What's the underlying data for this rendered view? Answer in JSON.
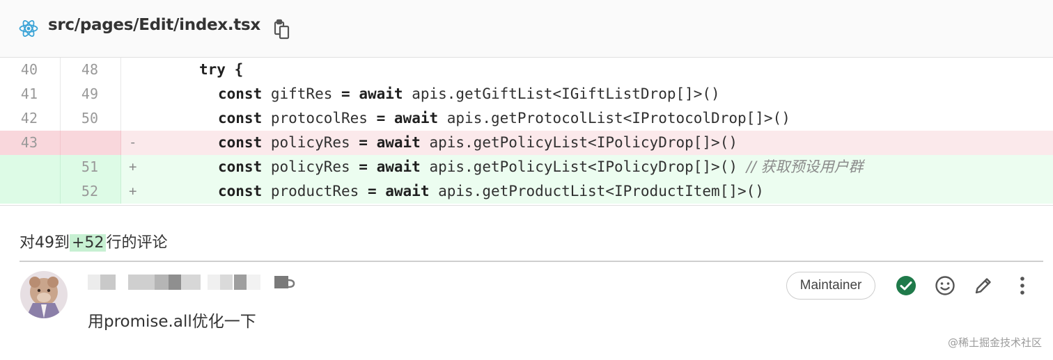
{
  "file": {
    "path": "src/pages/Edit/index.tsx",
    "icon": "react-icon",
    "copy_icon": "copy-icon"
  },
  "diff": {
    "rows": [
      {
        "type": "context",
        "old": "40",
        "new": "48",
        "marker": "",
        "code": "try {"
      },
      {
        "type": "context",
        "old": "41",
        "new": "49",
        "marker": "",
        "code": "const giftRes = await apis.getGiftList<IGiftListDrop[]>()"
      },
      {
        "type": "context",
        "old": "42",
        "new": "50",
        "marker": "",
        "code": "const protocolRes = await apis.getProtocolList<IProtocolDrop[]>()"
      },
      {
        "type": "del",
        "old": "43",
        "new": "",
        "marker": "-",
        "code": "const policyRes = await apis.getPolicyList<IPolicyDrop[]>()"
      },
      {
        "type": "add",
        "old": "",
        "new": "51",
        "marker": "+",
        "code": "const policyRes = await apis.getPolicyList<IPolicyDrop[]>() // 获取预设用户群"
      },
      {
        "type": "add",
        "old": "",
        "new": "52",
        "marker": "+",
        "code": "const productRes = await apis.getProductList<IProductItem[]>()"
      }
    ],
    "colors": {
      "deleted_bg": "#fbe9eb",
      "added_bg": "#ecfdf0"
    }
  },
  "comment": {
    "range_prefix": "对49到",
    "range_highlight": "+52",
    "range_suffix": "行的评论",
    "body": "用promise.all优化一下",
    "role_badge": "Maintainer",
    "actions": [
      "resolve-check-icon",
      "emoji-icon",
      "edit-pencil-icon",
      "more-vertical-icon"
    ],
    "resolve_color": "#1f7a4a"
  },
  "watermark": "@稀土掘金技术社区"
}
